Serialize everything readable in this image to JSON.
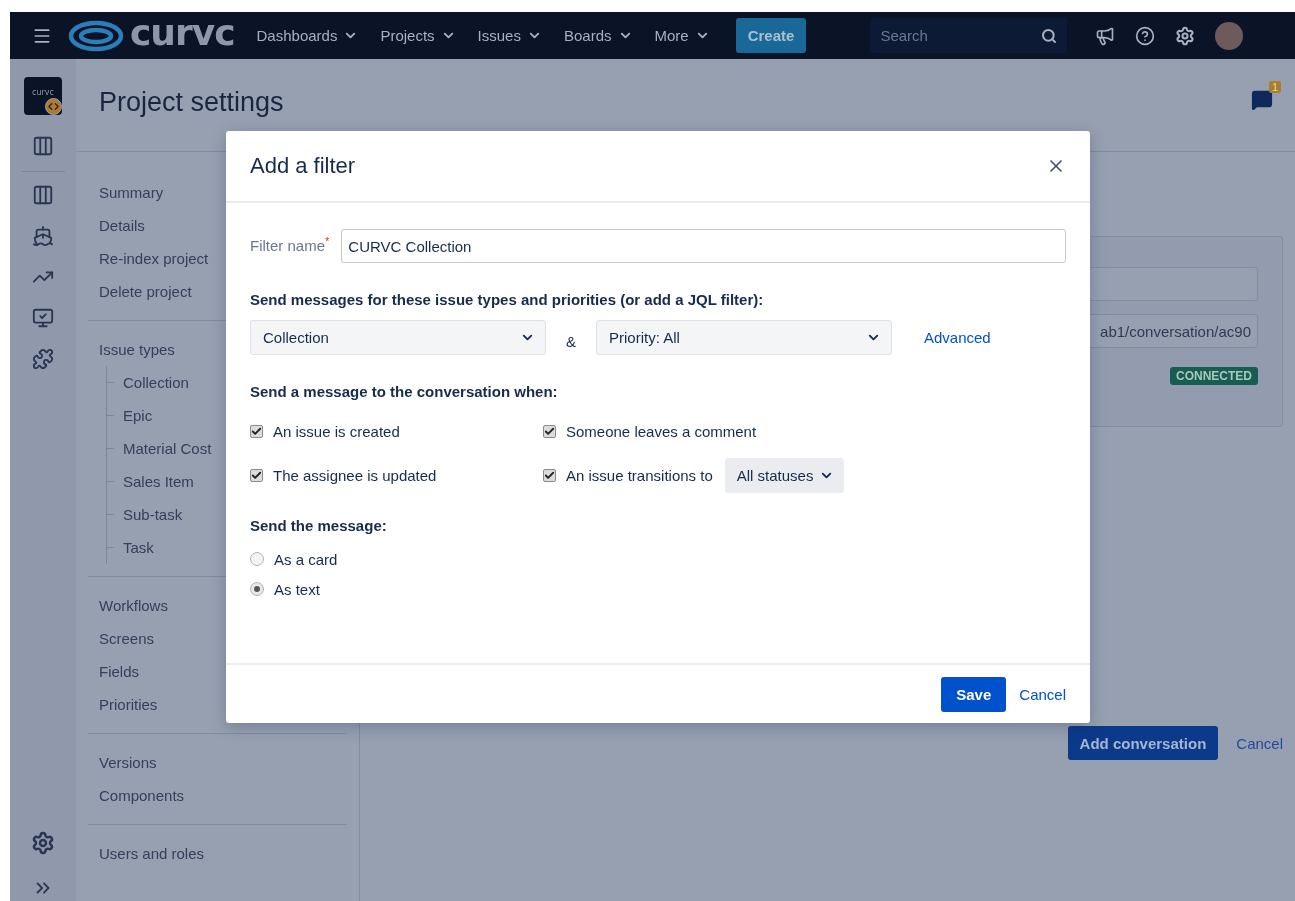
{
  "top_nav": {
    "logo_text": "curvc",
    "menus": [
      "Dashboards",
      "Projects",
      "Issues",
      "Boards",
      "More"
    ],
    "create_button": "Create",
    "search": {
      "placeholder": "Search"
    }
  },
  "project_rail": {
    "project_logo_text": "curvc"
  },
  "page": {
    "title": "Project settings",
    "notification_count": "1"
  },
  "settings_nav": {
    "sections": [
      {
        "items": [
          {
            "label": "Summary"
          },
          {
            "label": "Details"
          },
          {
            "label": "Re-index project"
          },
          {
            "label": "Delete project"
          }
        ]
      },
      {
        "items": [
          {
            "label": "Issue types",
            "children": [
              {
                "label": "Collection"
              },
              {
                "label": "Epic"
              },
              {
                "label": "Material Cost"
              },
              {
                "label": "Sales Item"
              },
              {
                "label": "Sub-task"
              },
              {
                "label": "Task"
              }
            ]
          }
        ]
      },
      {
        "items": [
          {
            "label": "Workflows"
          },
          {
            "label": "Screens"
          },
          {
            "label": "Fields"
          },
          {
            "label": "Priorities"
          }
        ]
      },
      {
        "items": [
          {
            "label": "Versions"
          },
          {
            "label": "Components"
          }
        ]
      },
      {
        "items": [
          {
            "label": "Users and roles"
          }
        ]
      }
    ]
  },
  "background_panel": {
    "field_value": "ab1/conversation/ac90",
    "status_badge": "CONNECTED",
    "primary_button": "Add conversation",
    "cancel_link": "Cancel"
  },
  "dialog": {
    "title": "Add a filter",
    "filter_name": {
      "label": "Filter name",
      "required_mark": "*",
      "value": "CURVC Collection"
    },
    "issue_filter": {
      "heading": "Send messages for these issue types and priorities (or add a JQL filter):",
      "issue_type": "Collection",
      "joiner": "&",
      "priority": "Priority: All",
      "advanced_link": "Advanced"
    },
    "triggers": {
      "heading": "Send a message to the conversation when:",
      "options": [
        {
          "label": "An issue is created",
          "checked": true
        },
        {
          "label": "Someone leaves a comment",
          "checked": true
        },
        {
          "label": "The assignee is updated",
          "checked": true
        },
        {
          "label": "An issue transitions to",
          "checked": true,
          "status_dropdown": "All statuses"
        }
      ]
    },
    "format": {
      "heading": "Send the message:",
      "options": [
        {
          "label": "As a card",
          "selected": false
        },
        {
          "label": "As text",
          "selected": true
        }
      ]
    },
    "buttons": {
      "save": "Save",
      "cancel": "Cancel"
    }
  }
}
